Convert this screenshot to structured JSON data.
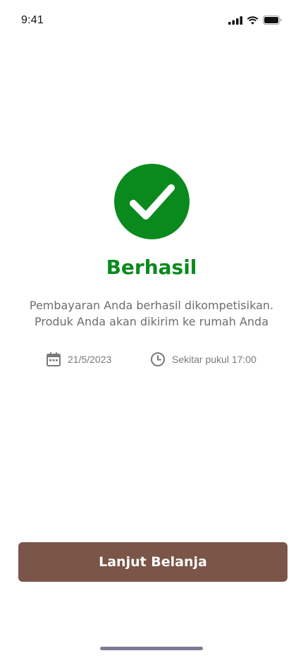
{
  "status_bar": {
    "time": "9:41",
    "icons": [
      "cellular-signal-icon",
      "wifi-icon",
      "battery-icon"
    ]
  },
  "success": {
    "icon": "checkmark-icon",
    "title": "Berhasil",
    "message_line1": "Pembayaran Anda berhasil dikompetisikan.",
    "message_line2": "Produk Anda akan dikirim ke rumah Anda"
  },
  "delivery": {
    "date_icon": "calendar-icon",
    "date": "21/5/2023",
    "time_icon": "clock-icon",
    "time": "Sekitar pukul 17:00"
  },
  "actions": {
    "continue_label": "Lanjut Belanja"
  },
  "colors": {
    "success_green": "#0a8a1c",
    "button_brown": "#7a5548",
    "text_gray": "#6d6d6d"
  }
}
